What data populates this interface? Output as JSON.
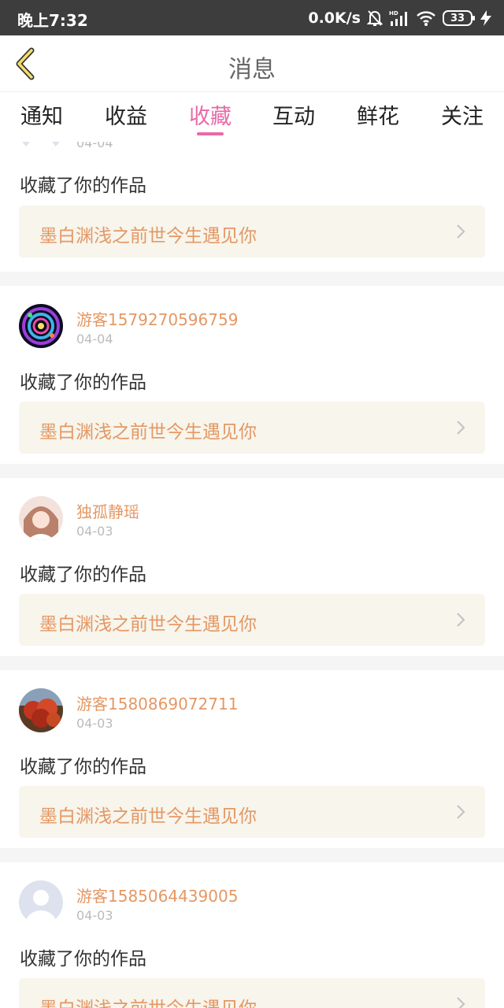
{
  "status_bar": {
    "time": "晚上7:32",
    "network_speed": "0.0K/s",
    "battery": "33",
    "hd_label": "HD"
  },
  "header": {
    "title": "消息"
  },
  "tabs": [
    {
      "label": "通知",
      "active": false
    },
    {
      "label": "收益",
      "active": false
    },
    {
      "label": "收藏",
      "active": true
    },
    {
      "label": "互动",
      "active": false
    },
    {
      "label": "鲜花",
      "active": false
    },
    {
      "label": "关注",
      "active": false
    }
  ],
  "colors": {
    "accent": "#e86aa8",
    "name": "#e49864",
    "work_bg": "#f7f5ec"
  },
  "messages": [
    {
      "user": "",
      "date": "04-04",
      "action": "收藏了你的作品",
      "work_title": "墨白渊浅之前世今生遇见你",
      "avatar": "default-avatar"
    },
    {
      "user": "游客1579270596759",
      "date": "04-04",
      "action": "收藏了你的作品",
      "work_title": "墨白渊浅之前世今生遇见你",
      "avatar": "colorful-pattern-avatar"
    },
    {
      "user": "独孤静瑶",
      "date": "04-03",
      "action": "收藏了你的作品",
      "work_title": "墨白渊浅之前世今生遇见你",
      "avatar": "portrait-avatar"
    },
    {
      "user": "游客1580869072711",
      "date": "04-03",
      "action": "收藏了你的作品",
      "work_title": "墨白渊浅之前世今生遇见你",
      "avatar": "autumn-tree-avatar"
    },
    {
      "user": "游客1585064439005",
      "date": "04-03",
      "action": "收藏了你的作品",
      "work_title": "墨白渊浅之前世今生遇见你",
      "avatar": "default-avatar"
    }
  ]
}
